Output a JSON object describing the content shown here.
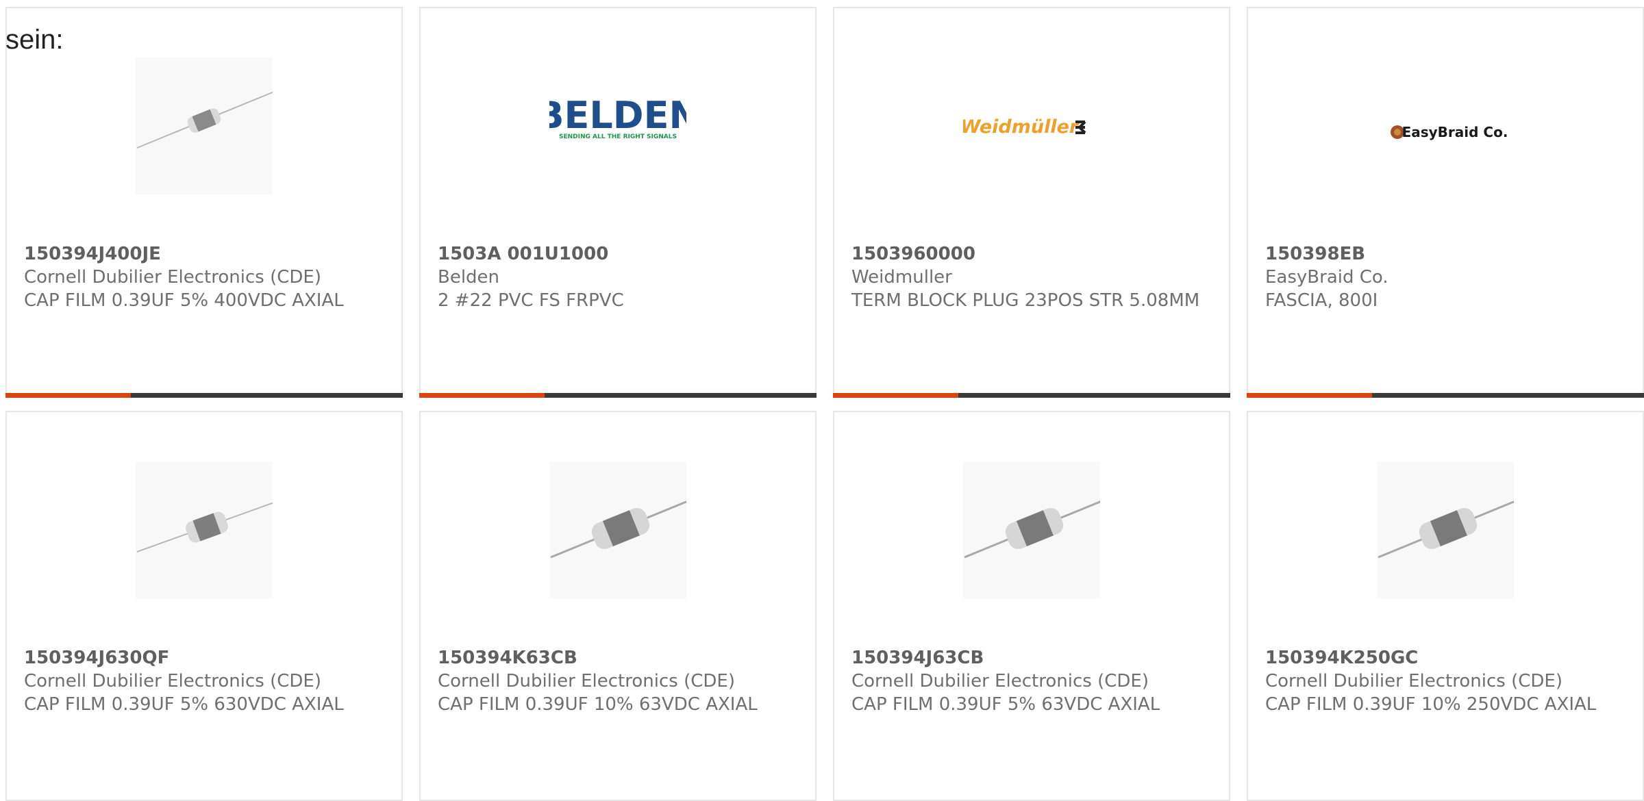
{
  "fragment_text": "sein:",
  "cards": [
    {
      "part": "150394J400JE",
      "mfr": "Cornell Dubilier Electronics (CDE)",
      "desc": "CAP FILM 0.39UF 5% 400VDC AXIAL",
      "image": "capacitor-thumbnail"
    },
    {
      "part": "1503A 001U1000",
      "mfr": "Belden",
      "desc": "2 #22 PVC FS FRPVC",
      "image": "belden-logo",
      "logo": {
        "name": "BELDEN",
        "tagline": "SENDING ALL THE RIGHT SIGNALS"
      }
    },
    {
      "part": "1503960000",
      "mfr": "Weidmuller",
      "desc": "TERM BLOCK PLUG 23POS STR 5.08MM",
      "image": "weidmuller-logo",
      "logo": {
        "name": "Weidmüller"
      }
    },
    {
      "part": "150398EB",
      "mfr": "EasyBraid Co.",
      "desc": "FASCIA, 800I",
      "image": "easybraid-logo",
      "logo": {
        "name": "EasyBraid Co."
      }
    },
    {
      "part": "150394J630QF",
      "mfr": "Cornell Dubilier Electronics (CDE)",
      "desc": "CAP FILM 0.39UF 5% 630VDC AXIAL",
      "image": "capacitor-thumbnail"
    },
    {
      "part": "150394K63CB",
      "mfr": "Cornell Dubilier Electronics (CDE)",
      "desc": "CAP FILM 0.39UF 10% 63VDC AXIAL",
      "image": "capacitor-thumbnail"
    },
    {
      "part": "150394J63CB",
      "mfr": "Cornell Dubilier Electronics (CDE)",
      "desc": "CAP FILM 0.39UF 5% 63VDC AXIAL",
      "image": "capacitor-thumbnail"
    },
    {
      "part": "150394K250GC",
      "mfr": "Cornell Dubilier Electronics (CDE)",
      "desc": "CAP FILM 0.39UF 10% 250VDC AXIAL",
      "image": "capacitor-thumbnail"
    }
  ],
  "colors": {
    "accent": "#e0420f",
    "bar": "#3a3a3a",
    "belden_blue": "#1f4e8c",
    "belden_green": "#1a9a4a",
    "weidmuller_orange": "#f0a02a"
  }
}
